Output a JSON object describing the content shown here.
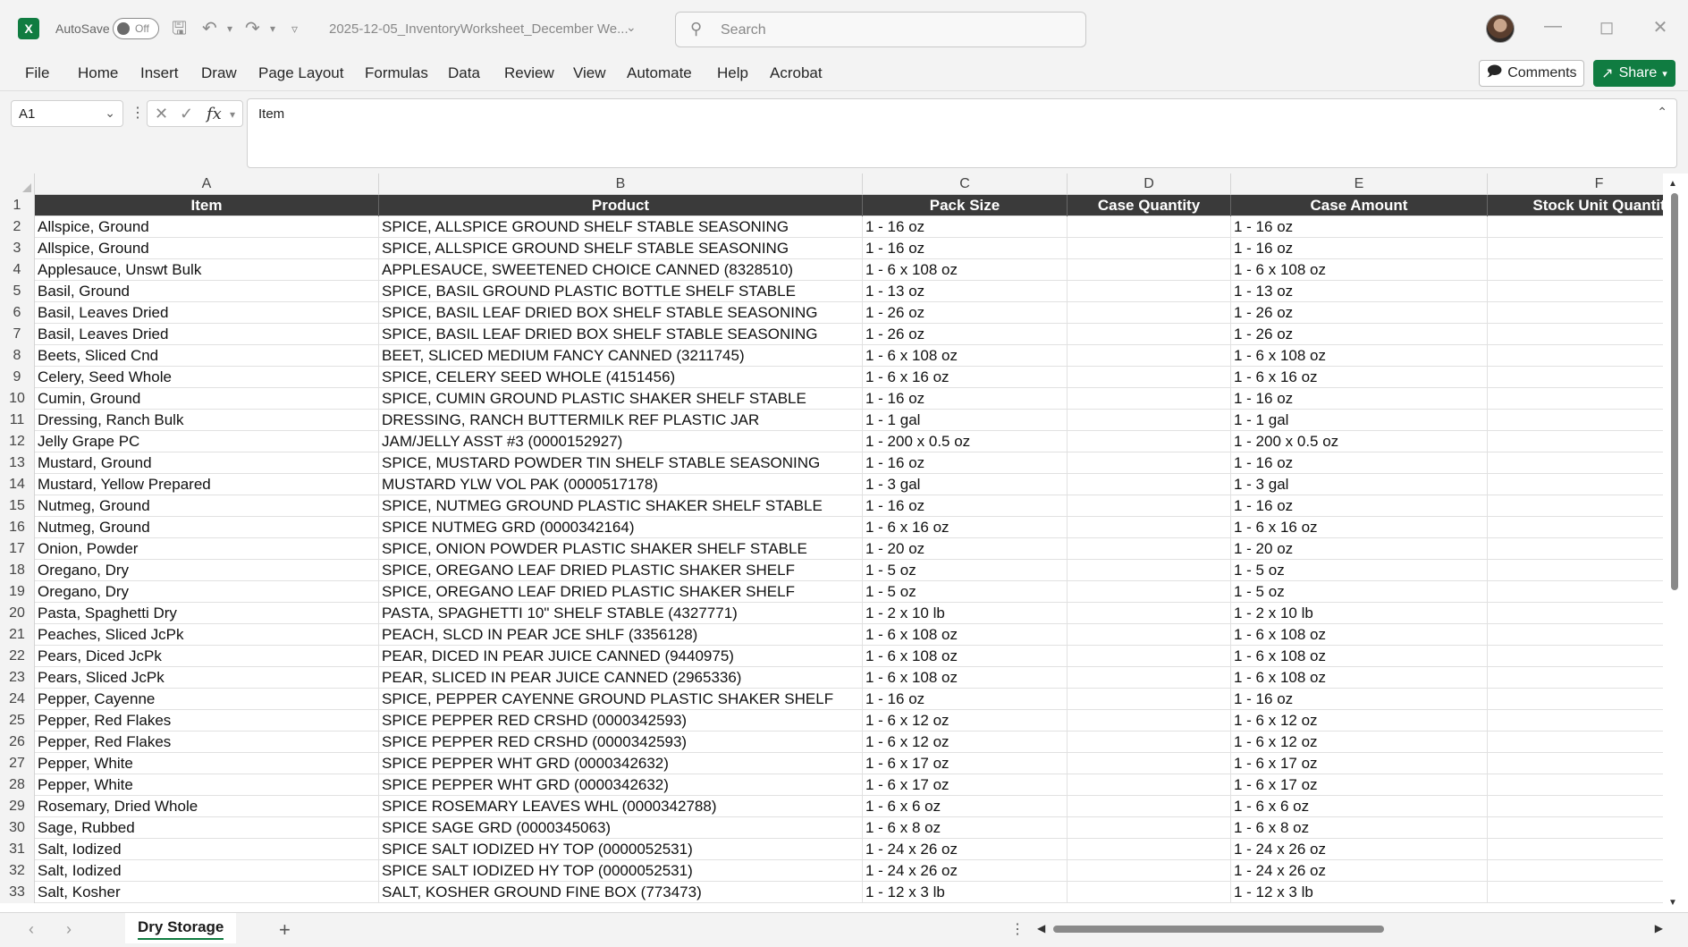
{
  "titlebar": {
    "app_icon": "X",
    "autosave_label": "AutoSave",
    "autosave_state": "Off",
    "document_title": "2025-12-05_InventoryWorksheet_December We...",
    "search_placeholder": "Search"
  },
  "ribbon": {
    "tabs": [
      "File",
      "Home",
      "Insert",
      "Draw",
      "Page Layout",
      "Formulas",
      "Data",
      "Review",
      "View",
      "Automate",
      "Help",
      "Acrobat"
    ],
    "comments_label": "Comments",
    "share_label": "Share"
  },
  "formula_bar": {
    "name_box": "A1",
    "fx": "fx",
    "value": "Item"
  },
  "columns": [
    "A",
    "B",
    "C",
    "D",
    "E",
    "F"
  ],
  "header": [
    "Item",
    "Product",
    "Pack Size",
    "Case Quantity",
    "Case Amount",
    "Stock Unit Quantit"
  ],
  "rows": [
    [
      "Allspice, Ground",
      "SPICE, ALLSPICE GROUND SHELF STABLE SEASONING",
      "1 - 16 oz",
      "",
      "1 - 16 oz",
      ""
    ],
    [
      "Allspice, Ground",
      "SPICE, ALLSPICE GROUND SHELF STABLE SEASONING",
      "1 - 16 oz",
      "",
      "1 - 16 oz",
      ""
    ],
    [
      "Applesauce, Unswt Bulk",
      "APPLESAUCE, SWEETENED CHOICE CANNED (8328510)",
      "1 - 6 x 108 oz",
      "",
      "1 - 6 x 108 oz",
      ""
    ],
    [
      "Basil, Ground",
      "SPICE, BASIL GROUND PLASTIC BOTTLE SHELF STABLE",
      "1 - 13 oz",
      "",
      "1 - 13 oz",
      ""
    ],
    [
      "Basil, Leaves Dried",
      "SPICE, BASIL LEAF DRIED BOX SHELF STABLE SEASONING",
      "1 - 26 oz",
      "",
      "1 - 26 oz",
      ""
    ],
    [
      "Basil, Leaves Dried",
      "SPICE, BASIL LEAF DRIED BOX SHELF STABLE SEASONING",
      "1 - 26 oz",
      "",
      "1 - 26 oz",
      ""
    ],
    [
      "Beets, Sliced Cnd",
      "BEET, SLICED MEDIUM FANCY CANNED (3211745)",
      "1 - 6 x 108 oz",
      "",
      "1 - 6 x 108 oz",
      ""
    ],
    [
      "Celery, Seed Whole",
      "SPICE, CELERY SEED WHOLE (4151456)",
      "1 - 6 x 16 oz",
      "",
      "1 - 6 x 16 oz",
      ""
    ],
    [
      "Cumin, Ground",
      "SPICE, CUMIN GROUND PLASTIC SHAKER SHELF STABLE",
      "1 - 16 oz",
      "",
      "1 - 16 oz",
      ""
    ],
    [
      "Dressing, Ranch Bulk",
      "DRESSING, RANCH BUTTERMILK REF PLASTIC JAR",
      "1 - 1 gal",
      "",
      "1 - 1 gal",
      ""
    ],
    [
      "Jelly Grape PC",
      "JAM/JELLY ASST #3 (0000152927)",
      "1 - 200 x 0.5 oz",
      "",
      "1 - 200 x 0.5 oz",
      ""
    ],
    [
      "Mustard, Ground",
      "SPICE, MUSTARD POWDER TIN SHELF STABLE SEASONING",
      "1 - 16 oz",
      "",
      "1 - 16 oz",
      ""
    ],
    [
      "Mustard, Yellow Prepared",
      "MUSTARD YLW VOL PAK (0000517178)",
      "1 - 3 gal",
      "",
      "1 - 3 gal",
      ""
    ],
    [
      "Nutmeg, Ground",
      "SPICE, NUTMEG GROUND PLASTIC SHAKER SHELF STABLE",
      "1 - 16 oz",
      "",
      "1 - 16 oz",
      ""
    ],
    [
      "Nutmeg, Ground",
      "SPICE NUTMEG GRD (0000342164)",
      "1 - 6 x 16 oz",
      "",
      "1 - 6 x 16 oz",
      ""
    ],
    [
      "Onion, Powder",
      "SPICE, ONION POWDER PLASTIC SHAKER SHELF STABLE",
      "1 - 20 oz",
      "",
      "1 - 20 oz",
      ""
    ],
    [
      "Oregano, Dry",
      "SPICE, OREGANO LEAF DRIED PLASTIC SHAKER SHELF",
      "1 - 5 oz",
      "",
      "1 - 5 oz",
      ""
    ],
    [
      "Oregano, Dry",
      "SPICE, OREGANO LEAF DRIED PLASTIC SHAKER SHELF",
      "1 - 5 oz",
      "",
      "1 - 5 oz",
      ""
    ],
    [
      "Pasta, Spaghetti Dry",
      "PASTA, SPAGHETTI 10\" SHELF STABLE (4327771)",
      "1 - 2 x 10 lb",
      "",
      "1 - 2 x 10 lb",
      ""
    ],
    [
      "Peaches, Sliced JcPk",
      "PEACH, SLCD IN PEAR JCE SHLF (3356128)",
      "1 - 6 x 108 oz",
      "",
      "1 - 6 x 108 oz",
      ""
    ],
    [
      "Pears, Diced JcPk",
      "PEAR, DICED IN PEAR JUICE CANNED (9440975)",
      "1 - 6 x 108 oz",
      "",
      "1 - 6 x 108 oz",
      ""
    ],
    [
      "Pears, Sliced JcPk",
      "PEAR, SLICED IN PEAR JUICE CANNED (2965336)",
      "1 - 6 x 108 oz",
      "",
      "1 - 6 x 108 oz",
      ""
    ],
    [
      "Pepper, Cayenne",
      "SPICE, PEPPER CAYENNE GROUND PLASTIC SHAKER SHELF",
      "1 - 16 oz",
      "",
      "1 - 16 oz",
      ""
    ],
    [
      "Pepper, Red Flakes",
      "SPICE PEPPER RED CRSHD (0000342593)",
      "1 - 6 x 12 oz",
      "",
      "1 - 6 x 12 oz",
      ""
    ],
    [
      "Pepper, Red Flakes",
      "SPICE PEPPER RED CRSHD (0000342593)",
      "1 - 6 x 12 oz",
      "",
      "1 - 6 x 12 oz",
      ""
    ],
    [
      "Pepper, White",
      "SPICE PEPPER WHT GRD (0000342632)",
      "1 - 6 x 17 oz",
      "",
      "1 - 6 x 17 oz",
      ""
    ],
    [
      "Pepper, White",
      "SPICE PEPPER WHT GRD (0000342632)",
      "1 - 6 x 17 oz",
      "",
      "1 - 6 x 17 oz",
      ""
    ],
    [
      "Rosemary, Dried Whole",
      "SPICE ROSEMARY LEAVES WHL (0000342788)",
      "1 - 6 x 6 oz",
      "",
      "1 - 6 x 6 oz",
      ""
    ],
    [
      "Sage, Rubbed",
      "SPICE SAGE GRD (0000345063)",
      "1 - 6 x 8 oz",
      "",
      "1 - 6 x 8 oz",
      ""
    ],
    [
      "Salt, Iodized",
      "SPICE SALT IODIZED HY TOP (0000052531)",
      "1 - 24 x 26 oz",
      "",
      "1 - 24 x 26 oz",
      ""
    ],
    [
      "Salt, Iodized",
      "SPICE SALT IODIZED HY TOP (0000052531)",
      "1 - 24 x 26 oz",
      "",
      "1 - 24 x 26 oz",
      ""
    ],
    [
      "Salt, Kosher",
      "SALT, KOSHER GROUND FINE BOX (773473)",
      "1 - 12 x 3 lb",
      "",
      "1 - 12 x 3 lb",
      ""
    ]
  ],
  "sheet_tabs": [
    "Dry Storage"
  ],
  "icons": {
    "save": "save-icon",
    "undo": "undo-icon",
    "redo": "redo-icon",
    "search": "search-icon",
    "comment": "comment-icon",
    "share": "share-icon"
  },
  "colors": {
    "accent": "#107c41",
    "header_fill": "#3a3a3a",
    "header_text": "#ffffff"
  }
}
